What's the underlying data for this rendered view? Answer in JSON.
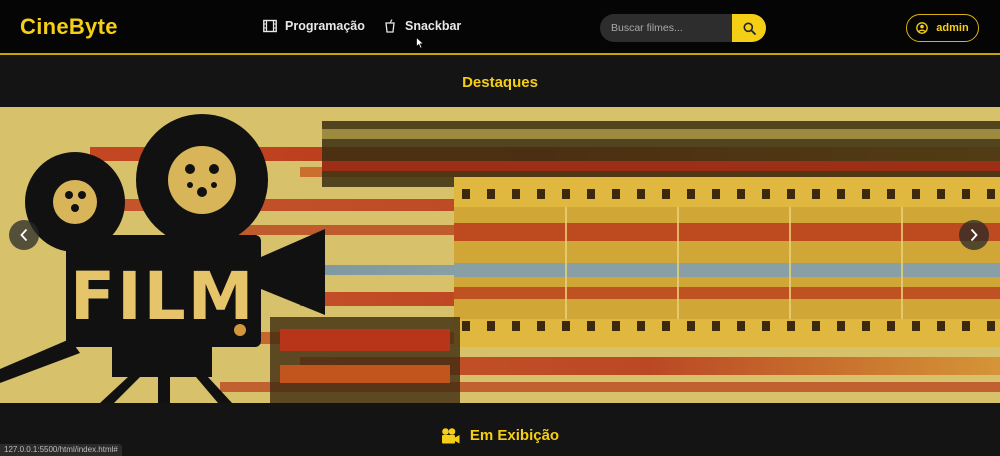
{
  "brand": "CineByte",
  "nav": {
    "programacao": "Programação",
    "snackbar": "Snackbar"
  },
  "search": {
    "placeholder": "Buscar filmes..."
  },
  "user": {
    "name": "admin"
  },
  "sections": {
    "destaques": "Destaques",
    "em_exibicao": "Em Exibição"
  },
  "status_bar": {
    "url": "127.0.0.1:5500/html/index.html#"
  },
  "banner": {
    "lettering": "FILM"
  },
  "colors": {
    "accent": "#f5cf16",
    "nav_bg": "#050505",
    "page_bg": "#141414"
  }
}
